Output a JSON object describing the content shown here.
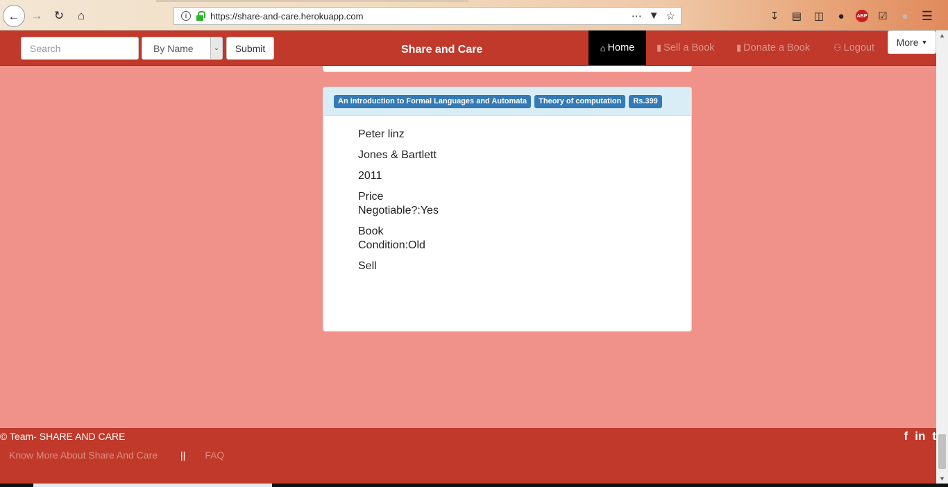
{
  "browser": {
    "url": "https://share-and-care.herokuapp.com",
    "icons": [
      "back-arrow-icon",
      "forward-arrow-icon",
      "reload-icon",
      "home-icon",
      "info-icon",
      "lock-icon",
      "more-dots-icon",
      "pocket-icon",
      "star-icon",
      "download-icon",
      "library-icon",
      "sidebar-icon",
      "lightbulb-icon",
      "adblock-icon",
      "checkbox-icon",
      "extension-icon",
      "hamburger-menu-icon"
    ],
    "adblock_label": "ABP"
  },
  "navbar": {
    "search_placeholder": "Search",
    "filter_selected": "By Name",
    "submit_label": "Submit",
    "brand": "Share and Care",
    "links": {
      "home": "Home",
      "sell": "Sell a Book",
      "donate": "Donate a Book",
      "logout": "Logout",
      "more": "More"
    },
    "colors": {
      "bar": "#c0392b",
      "active": "#000000",
      "link": "#d9958a"
    }
  },
  "book": {
    "title": "An Introduction to Formal Languages and Automata",
    "subject": "Theory of computation",
    "price": "Rs.399",
    "author": "Peter linz",
    "publisher": "Jones & Bartlett",
    "year": "2011",
    "negotiable": "Price Negotiable?:Yes",
    "condition": "Book Condition:Old",
    "type": "Sell",
    "colors": {
      "label": "#337ab7",
      "heading": "#d9edf7"
    }
  },
  "footer": {
    "copyright": "© Team- SHARE AND CARE",
    "link_about": "Know More About Share And Care",
    "separator": "||",
    "link_faq": "FAQ",
    "social": [
      "facebook-icon",
      "linkedin-icon",
      "twitter-icon"
    ],
    "social_glyphs": {
      "facebook": "f",
      "linkedin": "in",
      "twitter": "t"
    }
  },
  "page_background": "#f0928a"
}
